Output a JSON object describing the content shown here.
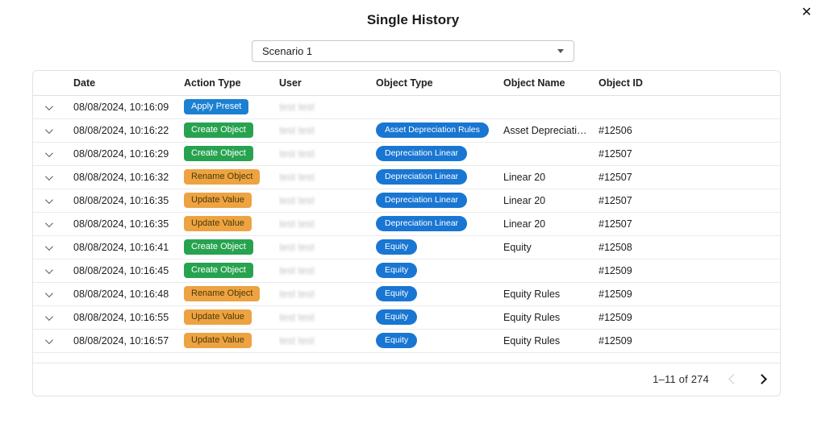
{
  "header": {
    "title": "Single History"
  },
  "icons": {
    "close": "✕"
  },
  "scenario_select": {
    "value": "Scenario 1"
  },
  "table": {
    "columns": [
      "Date",
      "Action Type",
      "User",
      "Object Type",
      "Object Name",
      "Object ID"
    ],
    "rows": [
      {
        "date": "08/08/2024, 10:16:09",
        "action": "Apply Preset",
        "badge": "blue",
        "user": "test test",
        "object_type": "",
        "object_name": "",
        "object_id": ""
      },
      {
        "date": "08/08/2024, 10:16:22",
        "action": "Create Object",
        "badge": "green",
        "user": "test test",
        "object_type": "Asset Depreciation Rules",
        "object_name": "Asset Depreciatio…",
        "object_id": "#12506"
      },
      {
        "date": "08/08/2024, 10:16:29",
        "action": "Create Object",
        "badge": "green",
        "user": "test test",
        "object_type": "Depreciation Linear",
        "object_name": "",
        "object_id": "#12507"
      },
      {
        "date": "08/08/2024, 10:16:32",
        "action": "Rename Object",
        "badge": "orange",
        "user": "test test",
        "object_type": "Depreciation Linear",
        "object_name": "Linear 20",
        "object_id": "#12507"
      },
      {
        "date": "08/08/2024, 10:16:35",
        "action": "Update Value",
        "badge": "orange",
        "user": "test test",
        "object_type": "Depreciation Linear",
        "object_name": "Linear 20",
        "object_id": "#12507"
      },
      {
        "date": "08/08/2024, 10:16:35",
        "action": "Update Value",
        "badge": "orange",
        "user": "test test",
        "object_type": "Depreciation Linear",
        "object_name": "Linear 20",
        "object_id": "#12507"
      },
      {
        "date": "08/08/2024, 10:16:41",
        "action": "Create Object",
        "badge": "green",
        "user": "test test",
        "object_type": "Equity",
        "object_name": "Equity",
        "object_id": "#12508"
      },
      {
        "date": "08/08/2024, 10:16:45",
        "action": "Create Object",
        "badge": "green",
        "user": "test test",
        "object_type": "Equity",
        "object_name": "",
        "object_id": "#12509"
      },
      {
        "date": "08/08/2024, 10:16:48",
        "action": "Rename Object",
        "badge": "orange",
        "user": "test test",
        "object_type": "Equity",
        "object_name": "Equity Rules",
        "object_id": "#12509"
      },
      {
        "date": "08/08/2024, 10:16:55",
        "action": "Update Value",
        "badge": "orange",
        "user": "test test",
        "object_type": "Equity",
        "object_name": "Equity Rules",
        "object_id": "#12509"
      },
      {
        "date": "08/08/2024, 10:16:57",
        "action": "Update Value",
        "badge": "orange",
        "user": "test test",
        "object_type": "Equity",
        "object_name": "Equity Rules",
        "object_id": "#12509"
      }
    ]
  },
  "pagination": {
    "label": "1–11 of 274"
  },
  "colors": {
    "action_badges": {
      "blue": {
        "bg": "#1b80d2",
        "fg": "#ffffff"
      },
      "green": {
        "bg": "#27a350",
        "fg": "#ffffff"
      },
      "orange": {
        "bg": "#eda341",
        "fg": "#4a3808"
      }
    },
    "object_type_badge": "#1976d2"
  }
}
